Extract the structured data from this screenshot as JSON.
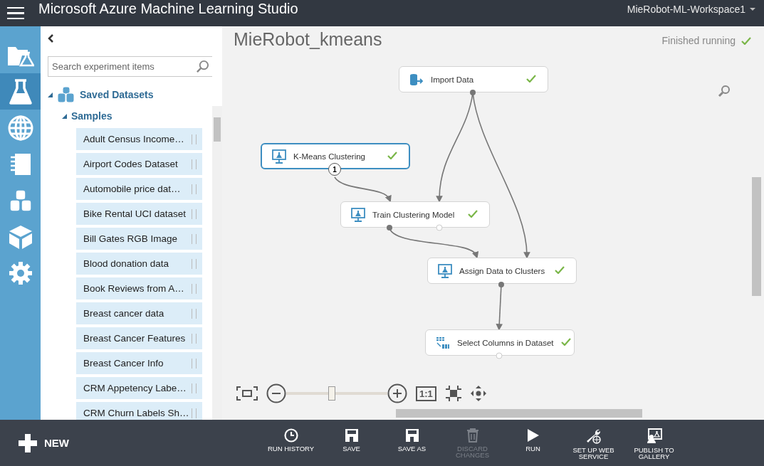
{
  "header": {
    "title": "Microsoft Azure Machine Learning Studio",
    "workspace": "MieRobot-ML-Workspace1"
  },
  "nav_rail": [
    {
      "selected": false
    },
    {
      "selected": true
    },
    {
      "selected": false
    },
    {
      "selected": false
    },
    {
      "selected": false
    },
    {
      "selected": false
    },
    {
      "selected": false
    }
  ],
  "palette": {
    "search": {
      "placeholder": "Search experiment items"
    },
    "tree": [
      {
        "label": "Saved Datasets",
        "expanded": true,
        "children": [
          {
            "label": "Samples",
            "expanded": true,
            "children": [
              {
                "label": "Adult Census Income…"
              },
              {
                "label": "Airport Codes Dataset"
              },
              {
                "label": "Automobile price dat…"
              },
              {
                "label": "Bike Rental UCI dataset"
              },
              {
                "label": "Bill Gates RGB Image"
              },
              {
                "label": "Blood donation data"
              },
              {
                "label": "Book Reviews from A…"
              },
              {
                "label": "Breast cancer data"
              },
              {
                "label": "Breast Cancer Features"
              },
              {
                "label": "Breast Cancer Info"
              },
              {
                "label": "CRM Appetency Labe…"
              },
              {
                "label": "CRM Churn Labels Sh…"
              }
            ]
          }
        ]
      }
    ]
  },
  "experiment": {
    "title": "MieRobot_kmeans",
    "status": "Finished running",
    "modules": [
      {
        "title": "Import Data",
        "kind": "data",
        "selected": false,
        "finished": true
      },
      {
        "title": "K-Means Clustering",
        "kind": "model",
        "selected": true,
        "finished": true,
        "badge": "1"
      },
      {
        "title": "Train Clustering Model",
        "kind": "model",
        "selected": false,
        "finished": true
      },
      {
        "title": "Assign Data to Clusters",
        "kind": "model",
        "selected": false,
        "finished": true
      },
      {
        "title": "Select Columns in Dataset",
        "kind": "columns",
        "selected": false,
        "finished": true
      }
    ],
    "zoom": {
      "level": 0.45,
      "actual_size": "1:1"
    }
  },
  "command_bar": {
    "new": "NEW",
    "actions": [
      {
        "label": "RUN HISTORY",
        "disabled": false
      },
      {
        "label": "SAVE",
        "disabled": false
      },
      {
        "label": "SAVE AS",
        "disabled": false
      },
      {
        "label": "DISCARD CHANGES",
        "disabled": true
      },
      {
        "label": "RUN",
        "disabled": false
      },
      {
        "label": "SET UP WEB SERVICE",
        "disabled": false
      },
      {
        "label": "PUBLISH TO GALLERY",
        "disabled": false
      }
    ]
  }
}
